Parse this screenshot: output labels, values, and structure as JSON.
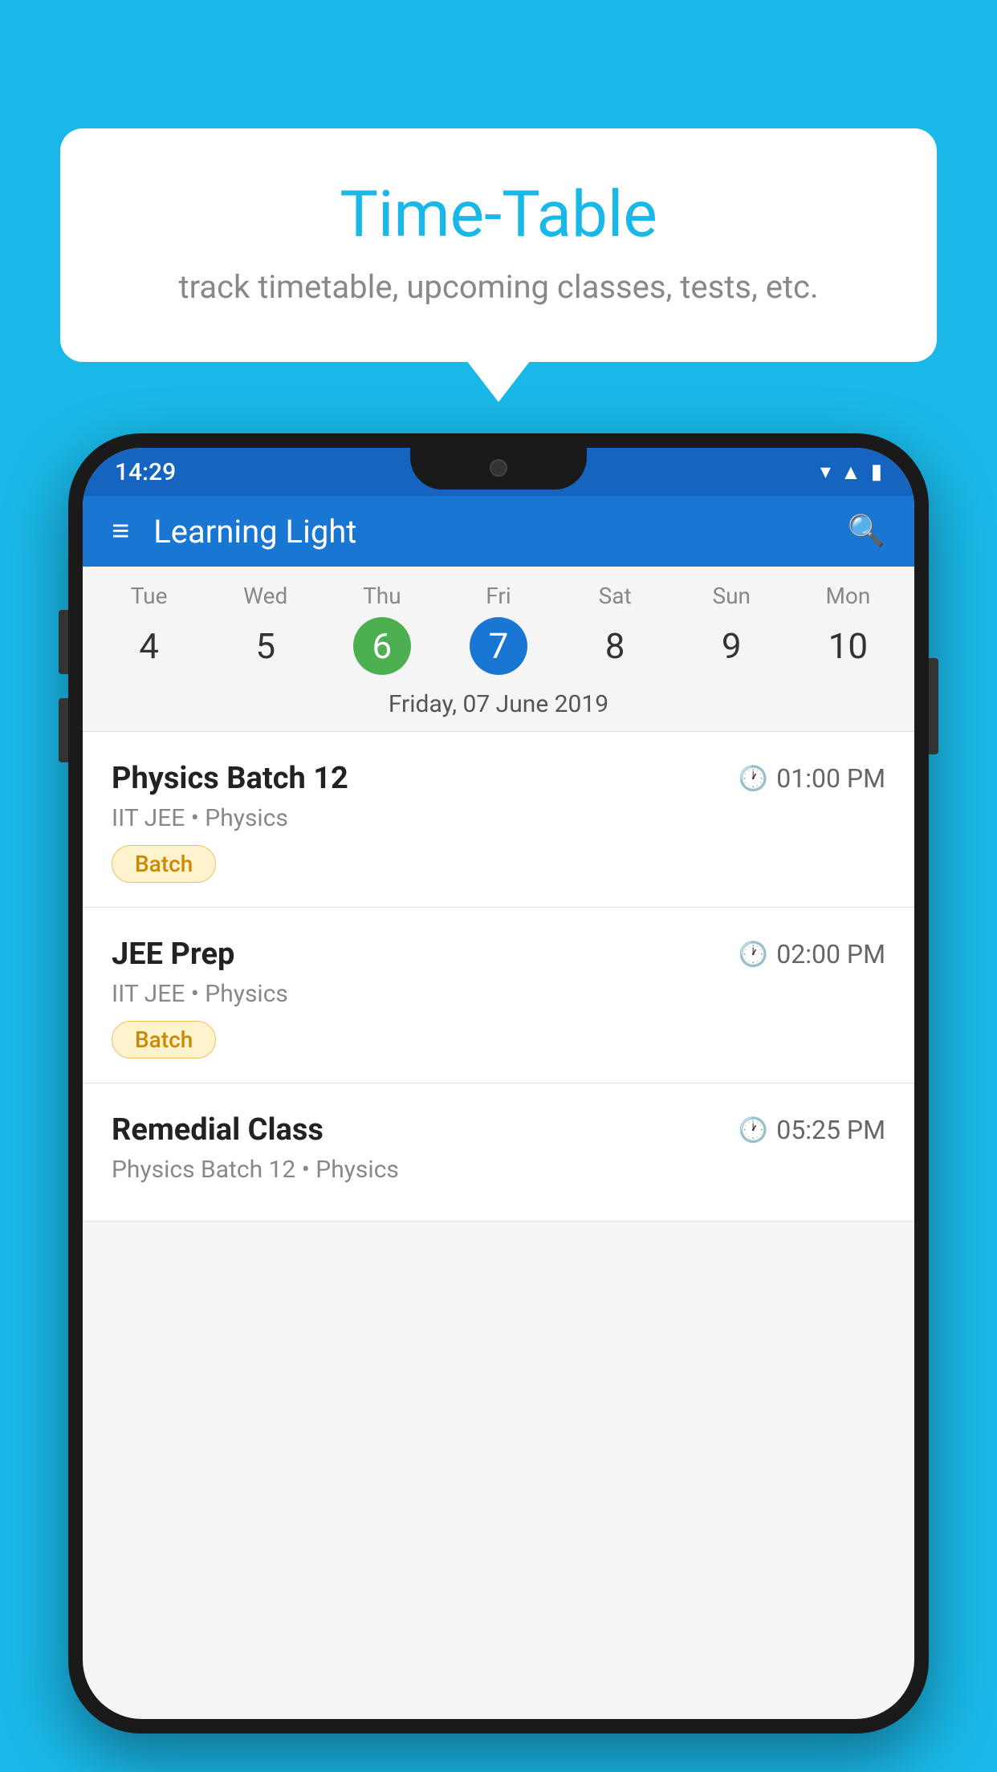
{
  "background_color": "#1ab8e8",
  "speech_bubble": {
    "title": "Time-Table",
    "subtitle": "track timetable, upcoming classes, tests, etc."
  },
  "phone": {
    "status_bar": {
      "time": "14:29",
      "icons": [
        "wifi",
        "signal",
        "battery"
      ]
    },
    "app_bar": {
      "title": "Learning Light",
      "menu_icon": "menu-icon",
      "search_icon": "search-icon"
    },
    "calendar": {
      "days": [
        {
          "name": "Tue",
          "number": "4",
          "style": "normal"
        },
        {
          "name": "Wed",
          "number": "5",
          "style": "normal"
        },
        {
          "name": "Thu",
          "number": "6",
          "style": "green"
        },
        {
          "name": "Fri",
          "number": "7",
          "style": "blue"
        },
        {
          "name": "Sat",
          "number": "8",
          "style": "normal"
        },
        {
          "name": "Sun",
          "number": "9",
          "style": "normal"
        },
        {
          "name": "Mon",
          "number": "10",
          "style": "normal"
        }
      ],
      "selected_date_label": "Friday, 07 June 2019"
    },
    "schedule": {
      "items": [
        {
          "name": "Physics Batch 12",
          "time": "01:00 PM",
          "subtitle": "IIT JEE • Physics",
          "badge": "Batch"
        },
        {
          "name": "JEE Prep",
          "time": "02:00 PM",
          "subtitle": "IIT JEE • Physics",
          "badge": "Batch"
        },
        {
          "name": "Remedial Class",
          "time": "05:25 PM",
          "subtitle": "Physics Batch 12 • Physics",
          "badge": ""
        }
      ]
    }
  }
}
